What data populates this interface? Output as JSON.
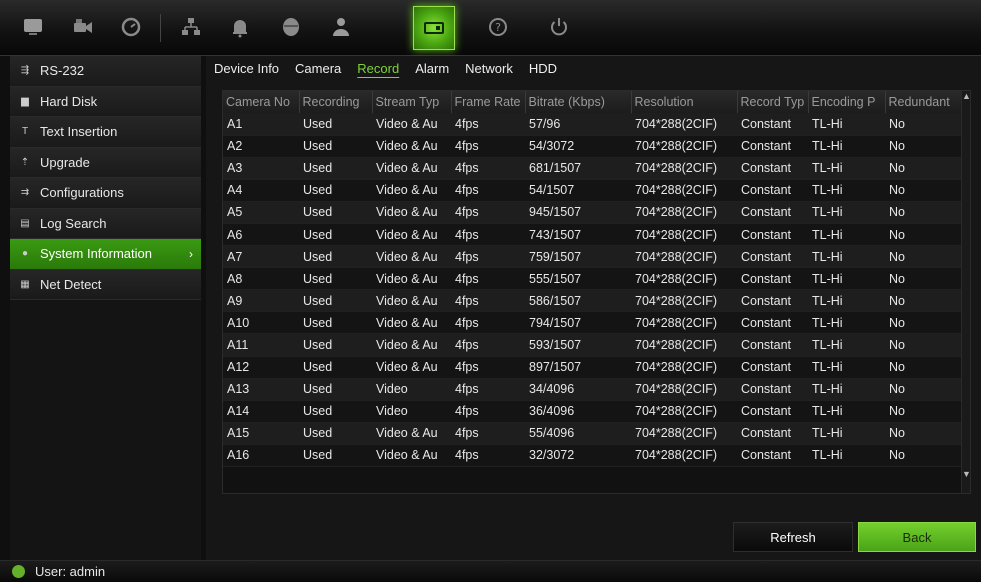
{
  "toolbar": {
    "icons": [
      "monitor-icon",
      "camera-icon",
      "clock-icon",
      "network-icon",
      "alarm-bell-icon",
      "device-icon",
      "user-icon",
      "system-info-icon",
      "help-icon",
      "power-icon"
    ],
    "active_index": 7
  },
  "sidebar": {
    "items": [
      {
        "label": "RS-232",
        "icon": "serial-port-icon"
      },
      {
        "label": "Hard Disk",
        "icon": "hard-disk-icon"
      },
      {
        "label": "Text Insertion",
        "icon": "text-icon"
      },
      {
        "label": "Upgrade",
        "icon": "upgrade-icon"
      },
      {
        "label": "Configurations",
        "icon": "config-icon"
      },
      {
        "label": "Log Search",
        "icon": "log-icon"
      },
      {
        "label": "System Information",
        "icon": "info-icon",
        "active": true
      },
      {
        "label": "Net Detect",
        "icon": "net-detect-icon"
      }
    ]
  },
  "tabs": [
    {
      "label": "Device Info"
    },
    {
      "label": "Camera"
    },
    {
      "label": "Record",
      "active": true
    },
    {
      "label": "Alarm"
    },
    {
      "label": "Network"
    },
    {
      "label": "HDD"
    }
  ],
  "table": {
    "headers": [
      "Camera No",
      "Recording",
      "Stream Typ",
      "Frame Rate",
      "Bitrate (Kbps)",
      "Resolution",
      "Record Typ",
      "Encoding P",
      "Redundant"
    ],
    "rows": [
      [
        "A1",
        "Used",
        "Video & Au",
        "4fps",
        "57/96",
        "704*288(2CIF)",
        "Constant",
        "TL-Hi",
        "No"
      ],
      [
        "A2",
        "Used",
        "Video & Au",
        "4fps",
        "54/3072",
        "704*288(2CIF)",
        "Constant",
        "TL-Hi",
        "No"
      ],
      [
        "A3",
        "Used",
        "Video & Au",
        "4fps",
        "681/1507",
        "704*288(2CIF)",
        "Constant",
        "TL-Hi",
        "No"
      ],
      [
        "A4",
        "Used",
        "Video & Au",
        "4fps",
        "54/1507",
        "704*288(2CIF)",
        "Constant",
        "TL-Hi",
        "No"
      ],
      [
        "A5",
        "Used",
        "Video & Au",
        "4fps",
        "945/1507",
        "704*288(2CIF)",
        "Constant",
        "TL-Hi",
        "No"
      ],
      [
        "A6",
        "Used",
        "Video & Au",
        "4fps",
        "743/1507",
        "704*288(2CIF)",
        "Constant",
        "TL-Hi",
        "No"
      ],
      [
        "A7",
        "Used",
        "Video & Au",
        "4fps",
        "759/1507",
        "704*288(2CIF)",
        "Constant",
        "TL-Hi",
        "No"
      ],
      [
        "A8",
        "Used",
        "Video & Au",
        "4fps",
        "555/1507",
        "704*288(2CIF)",
        "Constant",
        "TL-Hi",
        "No"
      ],
      [
        "A9",
        "Used",
        "Video & Au",
        "4fps",
        "586/1507",
        "704*288(2CIF)",
        "Constant",
        "TL-Hi",
        "No"
      ],
      [
        "A10",
        "Used",
        "Video & Au",
        "4fps",
        "794/1507",
        "704*288(2CIF)",
        "Constant",
        "TL-Hi",
        "No"
      ],
      [
        "A11",
        "Used",
        "Video & Au",
        "4fps",
        "593/1507",
        "704*288(2CIF)",
        "Constant",
        "TL-Hi",
        "No"
      ],
      [
        "A12",
        "Used",
        "Video & Au",
        "4fps",
        "897/1507",
        "704*288(2CIF)",
        "Constant",
        "TL-Hi",
        "No"
      ],
      [
        "A13",
        "Used",
        "Video",
        "4fps",
        "34/4096",
        "704*288(2CIF)",
        "Constant",
        "TL-Hi",
        "No"
      ],
      [
        "A14",
        "Used",
        "Video",
        "4fps",
        "36/4096",
        "704*288(2CIF)",
        "Constant",
        "TL-Hi",
        "No"
      ],
      [
        "A15",
        "Used",
        "Video & Au",
        "4fps",
        "55/4096",
        "704*288(2CIF)",
        "Constant",
        "TL-Hi",
        "No"
      ],
      [
        "A16",
        "Used",
        "Video & Au",
        "4fps",
        "32/3072",
        "704*288(2CIF)",
        "Constant",
        "TL-Hi",
        "No"
      ]
    ]
  },
  "buttons": {
    "refresh": "Refresh",
    "back": "Back"
  },
  "status": {
    "user": "User: admin"
  },
  "colors": {
    "accent": "#5fbf1c",
    "active_tab": "#7ed23a",
    "background": "#0f0f0f"
  }
}
